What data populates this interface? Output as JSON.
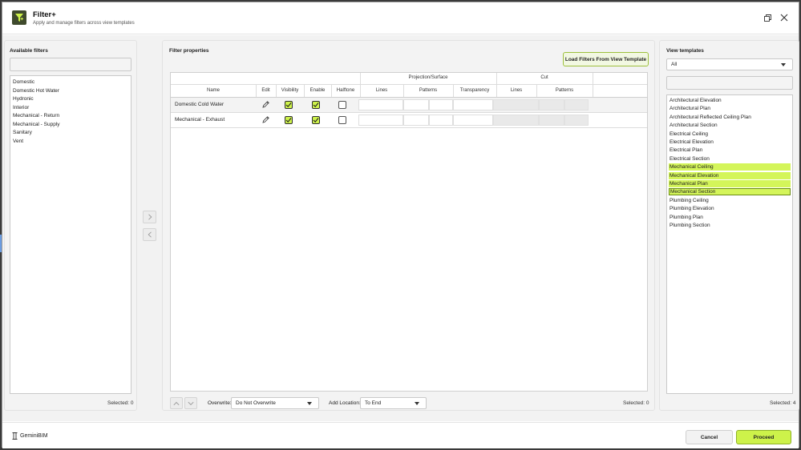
{
  "window": {
    "title": "Filter+",
    "subtitle": "Apply and manage filters across view templates"
  },
  "available_filters": {
    "title": "Available filters",
    "search_value": "",
    "items": [
      "Domestic",
      "Domestic Hot Water",
      "Hydronic",
      "Interior",
      "Mechanical - Return",
      "Mechanical - Supply",
      "Sanitary",
      "Vent"
    ],
    "selected_label": "Selected:",
    "selected_count": "0"
  },
  "filter_properties": {
    "title": "Filter properties",
    "load_button": "Load Filters From View Template",
    "group_headers": {
      "projection": "Projection/Surface",
      "cut": "Cut"
    },
    "columns": {
      "name": "Name",
      "edit": "Edit",
      "visibility": "Visibility",
      "enable": "Enable",
      "halftone": "Halftone",
      "proj_lines": "Lines",
      "proj_patterns": "Patterns",
      "transparency": "Transparency",
      "cut_lines": "Lines",
      "cut_patterns": "Patterns"
    },
    "rows": [
      {
        "name": "Domestic Cold Water",
        "visibility": true,
        "enable": true,
        "halftone": false
      },
      {
        "name": "Mechanical - Exhaust",
        "visibility": true,
        "enable": true,
        "halftone": false
      }
    ],
    "overwrite_label": "Overwrite:",
    "overwrite_value": "Do Not Overwrite",
    "add_location_label": "Add Location:",
    "add_location_value": "To End",
    "selected_label": "Selected:",
    "selected_count": "0"
  },
  "view_templates": {
    "title": "View templates",
    "filter_value": "All",
    "search_value": "",
    "items": [
      {
        "label": "Architectural Elevation",
        "selected": false
      },
      {
        "label": "Architectural Plan",
        "selected": false
      },
      {
        "label": "Architectural Reflected Ceiling Plan",
        "selected": false
      },
      {
        "label": "Architectural Section",
        "selected": false
      },
      {
        "label": "Electrical Ceiling",
        "selected": false
      },
      {
        "label": "Electrical Elevation",
        "selected": false
      },
      {
        "label": "Electrical Plan",
        "selected": false
      },
      {
        "label": "Electrical Section",
        "selected": false
      },
      {
        "label": "Mechanical Ceiling",
        "selected": true
      },
      {
        "label": "Mechanical Elevation",
        "selected": true
      },
      {
        "label": "Mechanical Plan",
        "selected": true
      },
      {
        "label": "Mechanical Section",
        "selected": true
      },
      {
        "label": "Plumbing Ceiling",
        "selected": false
      },
      {
        "label": "Plumbing Elevation",
        "selected": false
      },
      {
        "label": "Plumbing Plan",
        "selected": false
      },
      {
        "label": "Plumbing Section",
        "selected": false
      }
    ],
    "selected_label": "Selected:",
    "selected_count": "4"
  },
  "footer": {
    "brand": "GeminiBIM",
    "cancel": "Cancel",
    "proceed": "Proceed"
  },
  "colors": {
    "accent": "#cdf24a",
    "selection": "#d4f55a",
    "logo_bg": "#3f4a2d"
  },
  "icons": {
    "app": "filter-plus-icon",
    "maximize": "restore-icon",
    "close": "close-icon",
    "move_right": "chevron-right-icon",
    "move_left": "chevron-left-icon",
    "edit": "pencil-icon",
    "move_up": "chevron-up-icon",
    "move_down": "chevron-down-icon",
    "brand": "column-icon"
  }
}
